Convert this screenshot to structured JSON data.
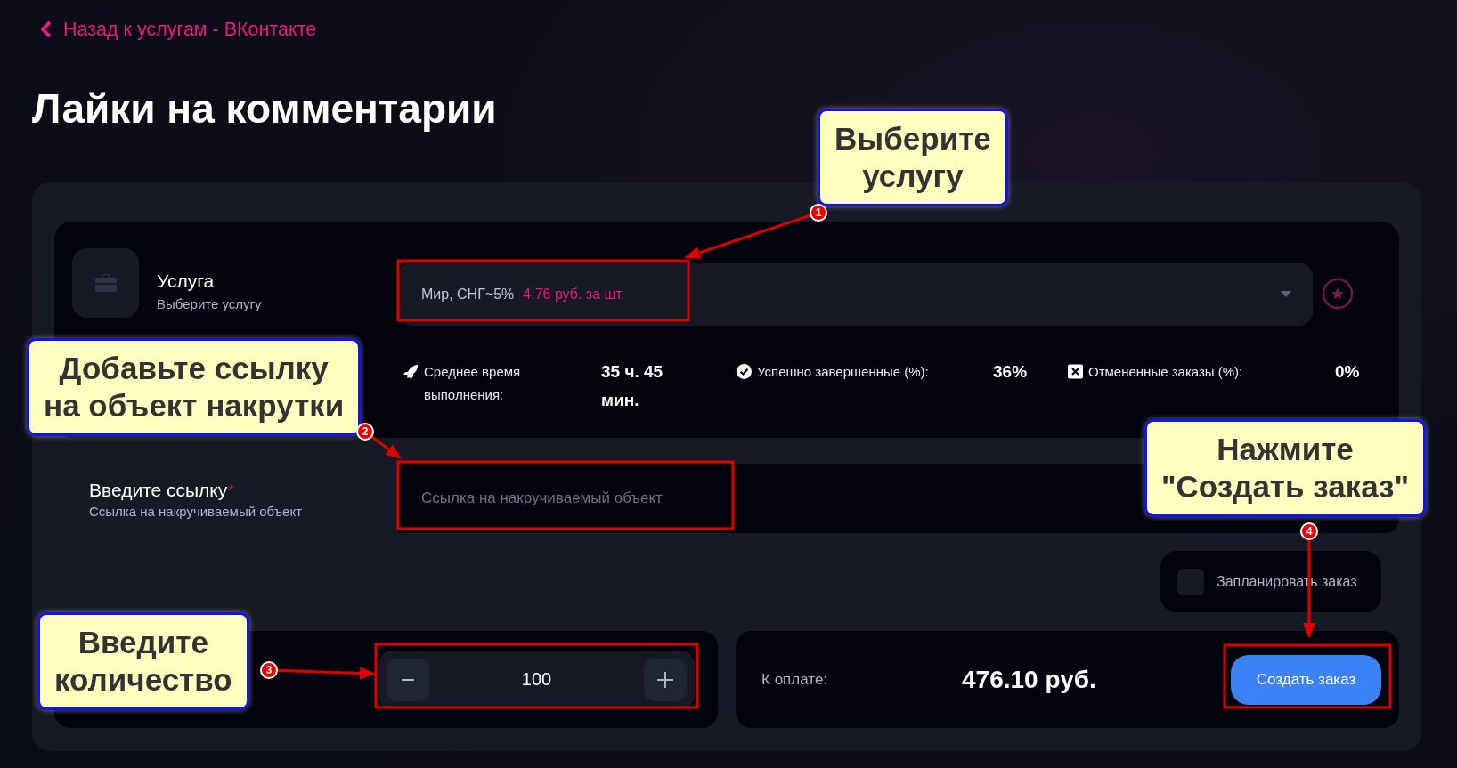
{
  "back_link": {
    "text": "Назад к услугам - ВКонтакте"
  },
  "title": "Лайки на комментарии",
  "service": {
    "label": "Услуга",
    "hint": "Выберите услугу",
    "selected_name": "Мир, СНГ~5%",
    "selected_price": "4.76 руб. за шт."
  },
  "stats": [
    {
      "kind": "time",
      "label": "Среднее время выполнения:",
      "value": "35 ч. 45 мин."
    },
    {
      "kind": "success",
      "label": "Успешно завершенные (%):",
      "value": "36%"
    },
    {
      "kind": "cancelled",
      "label": "Отмененные заказы (%):",
      "value": "0%"
    }
  ],
  "link": {
    "label": "Введите ссылку",
    "required_mark": "*",
    "hint": "Ссылка на накручиваемый объект",
    "placeholder": "Ссылка на накручиваемый объект"
  },
  "schedule": {
    "label": "Запланировать заказ",
    "checked": false
  },
  "quantity": {
    "value": "100"
  },
  "payment": {
    "label": "К оплате:",
    "amount": "476.10 руб.",
    "button": "Создать заказ"
  },
  "annotations": [
    {
      "number": "1",
      "lines": [
        "Выберите",
        "услугу"
      ]
    },
    {
      "number": "2",
      "lines": [
        "Добавьте ссылку",
        "на объект накрутки"
      ]
    },
    {
      "number": "3",
      "lines": [
        "Введите",
        "количество"
      ]
    },
    {
      "number": "4",
      "lines": [
        "Нажмите",
        "\"Создать заказ\""
      ]
    }
  ]
}
